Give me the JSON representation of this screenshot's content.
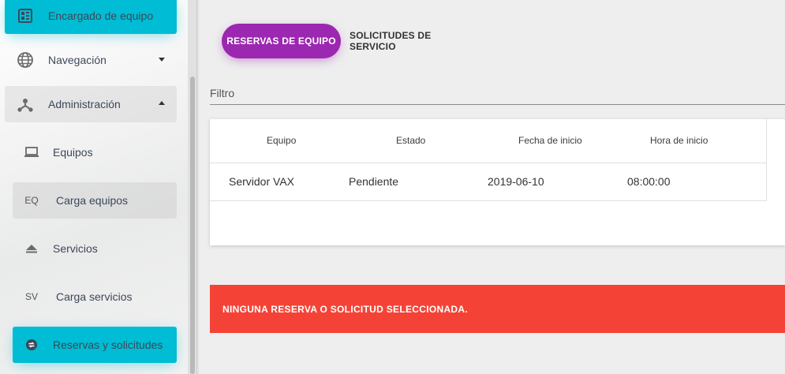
{
  "sidebar": {
    "encargado_label": "Encargado de equipo",
    "navegacion_label": "Navegación",
    "administracion_label": "Administración",
    "items": [
      {
        "label": "Equipos",
        "icon": "laptop-icon"
      },
      {
        "mini": "EQ",
        "label": "Carga equipos"
      },
      {
        "label": "Servicios",
        "icon": "eject-icon"
      },
      {
        "mini": "SV",
        "label": "Carga servicios"
      },
      {
        "label": "Reservas y solicitudes",
        "icon": "swap-icon"
      }
    ]
  },
  "tabs": {
    "active": "RESERVAS DE EQUIPO",
    "inactive": "SOLICITUDES DE SERVICIO"
  },
  "filter": {
    "placeholder": "Filtro"
  },
  "table": {
    "headers": [
      "Equipo",
      "Estado",
      "Fecha de inicio",
      "Hora de inicio"
    ],
    "rows": [
      [
        "Servidor VAX",
        "Pendiente",
        "2019-06-10",
        "08:00:00"
      ]
    ]
  },
  "alert": {
    "text": "NINGUNA RESERVA O SOLICITUD SELECCIONADA."
  },
  "colors": {
    "accent_cyan": "#00bcd4",
    "tab_purple": "#9c27b0",
    "alert_red": "#f44336"
  }
}
